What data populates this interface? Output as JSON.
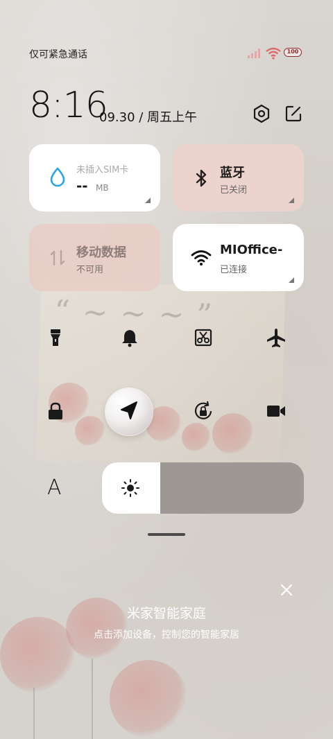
{
  "status_bar": {
    "carrier_text": "仅可紧急通话",
    "battery": "100"
  },
  "header": {
    "time": "8:16",
    "date": "09.30 / 周五上午",
    "icons": [
      "gear-icon",
      "edit-icon"
    ]
  },
  "tiles": [
    {
      "id": "data-usage",
      "label": "未插入SIM卡",
      "value": "--",
      "unit": "MB",
      "icon": "water-drop-icon",
      "state": "on"
    },
    {
      "id": "bluetooth",
      "label": "蓝牙",
      "status": "已关闭",
      "icon": "bluetooth-icon",
      "state": "off"
    },
    {
      "id": "mobile-data",
      "label": "移动数据",
      "status": "不可用",
      "icon": "mobile-data-icon",
      "state": "disabled"
    },
    {
      "id": "wifi",
      "label": "MIOffice-",
      "status": "已连接",
      "icon": "wifi-icon",
      "state": "on"
    }
  ],
  "quick_toggles_row1": [
    "flashlight-icon",
    "bell-icon",
    "screenshot-icon",
    "airplane-icon"
  ],
  "quick_toggles_row2": [
    "lock-icon",
    "location-icon",
    "rotation-lock-icon",
    "video-icon"
  ],
  "brightness": {
    "level": 0.29,
    "font_label": "A"
  },
  "smart_home": {
    "title": "米家智能家庭",
    "subtitle": "点击添加设备，控制您的智能家居"
  },
  "colors": {
    "tile_white": "#ffffff",
    "tile_pink": "#ecd3cd",
    "wifi_accent": "#e06a6a",
    "battery_outline": "#8a2b2b"
  }
}
